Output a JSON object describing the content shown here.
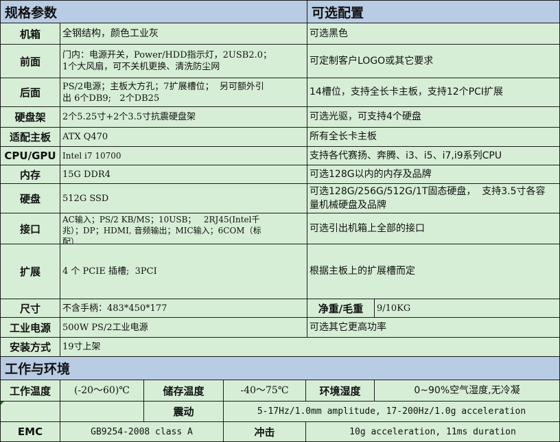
{
  "header": {
    "left": "规格参数",
    "right": "可选配置"
  },
  "rows": {
    "chassis": {
      "label": "机箱",
      "value": "全钢结构，颜色工业灰",
      "option": "可选黑色"
    },
    "front": {
      "label": "前面",
      "value": "门内：电源开关，Power/HDD指示灯，2USB2.0；\n1个大风扇，可不关机更换、清洗防尘网",
      "option": "可定制客户LOGO或其它要求"
    },
    "rear": {
      "label": "后面",
      "value": "PS/2电源；主板大方孔；7扩展槽位；  另可额外引\n出 6个DB9;   2个DB25",
      "option": "14槽位，支持全长卡主板，支持12个PCI扩展"
    },
    "drive_bay": {
      "label": "硬盘架",
      "value": "2个5.25寸+2个3.5寸抗震硬盘架",
      "option": "可选光驱，可支持4个硬盘"
    },
    "motherboard": {
      "label": "适配主板",
      "value": "ATX Q470",
      "option": "所有全长卡主板"
    },
    "cpu": {
      "label": "CPU/GPU",
      "value": "Intel i7 10700",
      "option": "支持各代赛扬、奔腾、i3、i5、i7,i9系列CPU"
    },
    "memory": {
      "label": "内存",
      "value": "15G DDR4",
      "option": "可选128G以内的内存及品牌"
    },
    "disk": {
      "label": "硬盘",
      "value": "512G SSD",
      "option": "可选128G/256G/512G/1T固态硬盘，  支持3.5寸各容\n量机械硬盘及品牌"
    },
    "ports": {
      "label": "接口",
      "value": "AC输入；PS/2 KB/MS；10USB；   2RJ45(Intel千\n兆）；DP；HDMI, 音频输出；MIC输入；6COM（标\n配）",
      "option": "可选引出机箱上全部的接口"
    },
    "expansion": {
      "label": "扩展",
      "value": "4 个 PCIE 插槽;  3PCI",
      "option": "根据主板上的扩展槽而定"
    },
    "size": {
      "label": "尺寸",
      "value": "不含手柄：483*450*177",
      "weight_label": "净重/毛重",
      "weight_value": "9/10KG"
    },
    "psu": {
      "label": "工业电源",
      "value": "500W PS/2工业电源",
      "option": "可选其它更高功率"
    },
    "mount": {
      "label": "安装方式",
      "value": "19寸上架"
    }
  },
  "env": {
    "header": "工作与环境",
    "op_temp_label": "工作温度",
    "op_temp_value": "(-20～60)℃",
    "storage_temp_label": "储存温度",
    "storage_temp_value": "-40～75℃",
    "humidity_label": "环境湿度",
    "humidity_value": "0~90%空气湿度,无冷凝",
    "vibration_label": "震动",
    "vibration_value": "5-17Hz/1.0mm amplitude, 17-200Hz/1.0g acceleration",
    "emc_label": "EMC",
    "emc_value": "GB9254-2008 class A",
    "shock_label": "冲击",
    "shock_value": "10g acceleration, 11ms duration"
  },
  "colors": {
    "header_bg": "#b8cce4",
    "cell_bg": "#d6eed6",
    "border": "#1a1a1a",
    "marker": "#1f7a1f"
  }
}
